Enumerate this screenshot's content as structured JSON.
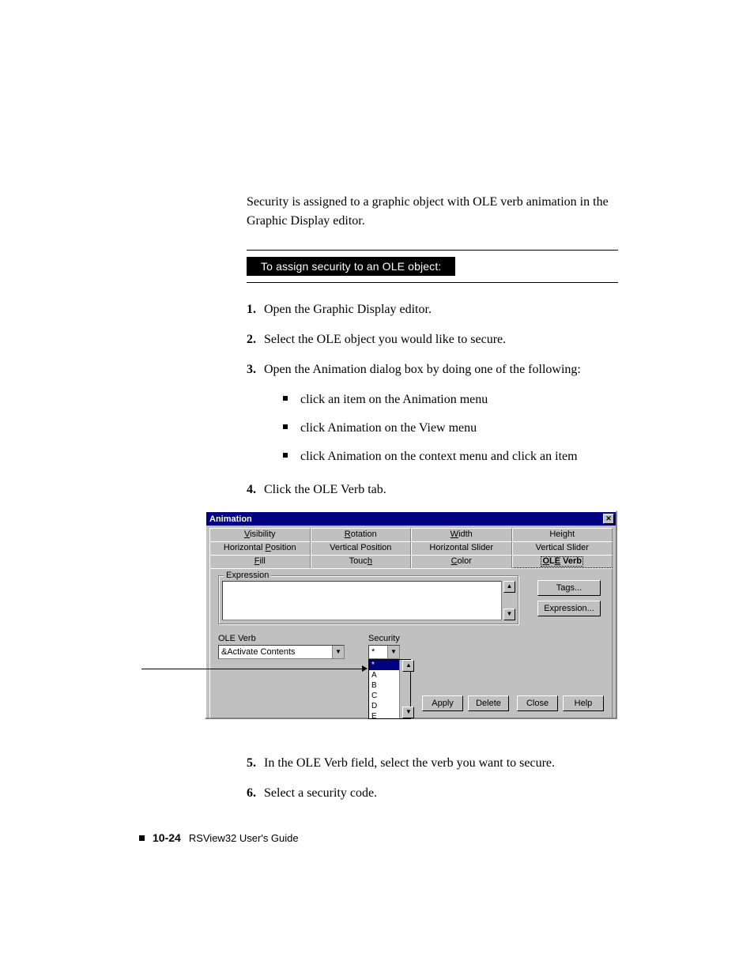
{
  "intro": "Security is assigned to a graphic object with OLE verb animation in the Graphic Display editor.",
  "section_heading": "To assign security to an OLE object:",
  "steps": {
    "s1": "Open the Graphic Display editor.",
    "s2": "Select the OLE object you would like to secure.",
    "s3": "Open the Animation dialog box by doing one of the following:",
    "bullets": [
      "click an item on the Animation menu",
      "click Animation on the View menu",
      "click Animation on the context menu and click an item"
    ],
    "s4": "Click the OLE Verb tab.",
    "s5": "In the OLE Verb field, select the verb you want to secure.",
    "s6": "Select a security code."
  },
  "dialog": {
    "title": "Animation",
    "tabs_row1": [
      "Visibility",
      "Rotation",
      "Width",
      "Height"
    ],
    "tabs_row2": [
      "Horizontal Position",
      "Vertical Position",
      "Horizontal Slider",
      "Vertical Slider"
    ],
    "tabs_row3": [
      "Fill",
      "Touch",
      "Color",
      "OLE Verb"
    ],
    "active_tab": "OLE Verb",
    "group_label": "Expression",
    "side_buttons": [
      "Tags...",
      "Expression..."
    ],
    "ole_verb_label": "OLE Verb",
    "ole_verb_value": "&Activate Contents",
    "security_label": "Security",
    "security_value": "*",
    "security_options": [
      "*",
      "A",
      "B",
      "C",
      "D",
      "E"
    ],
    "buttons_left": [
      "Apply",
      "Delete"
    ],
    "buttons_right": [
      "Close",
      "Help"
    ]
  },
  "footer": {
    "page": "10-24",
    "book": "RSView32  User's Guide"
  }
}
